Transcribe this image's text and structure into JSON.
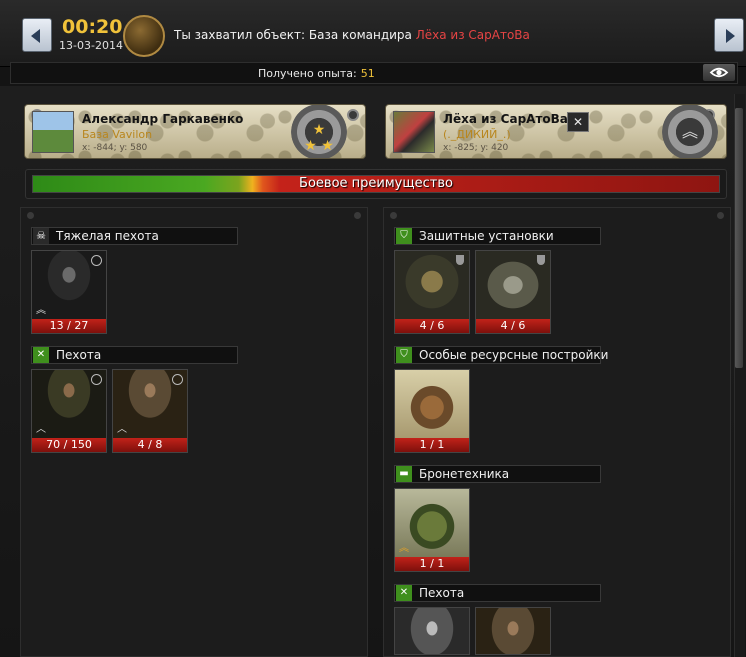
{
  "header": {
    "time": "00:20",
    "date": "13-03-2014",
    "headline_prefix": "Ты захватил объект: База командира",
    "headline_enemy": "Лёха из СарАтоВа",
    "xp_label": "Получено опыта:",
    "xp_value": "51",
    "prev_icon": "chevron-left-icon",
    "next_icon": "chevron-right-icon",
    "eye_icon": "eye-icon"
  },
  "players": {
    "left": {
      "name": "Александр Гаркавенко",
      "base": "База Vavilon",
      "coords": "x: -844; y: 580"
    },
    "right": {
      "name": "Лёха из СарАтоВа",
      "base": "(._ДИКИЙ_.)",
      "coords": "x: -825; y: 420",
      "close_label": "✕"
    }
  },
  "advantage": {
    "label": "Боевое преимущество",
    "player_share_percent": 32
  },
  "left_column": {
    "categories": [
      {
        "label": "Тяжелая пехота",
        "icon": "skull-icon",
        "units": [
          {
            "have": "13",
            "total": "27"
          }
        ]
      },
      {
        "label": "Пехота",
        "icon": "crossed-swords-icon",
        "units": [
          {
            "have": "70",
            "total": "150"
          },
          {
            "have": "4",
            "total": "8"
          }
        ]
      }
    ]
  },
  "right_column": {
    "categories": [
      {
        "label": "Зашитные установки",
        "icon": "shield-icon",
        "units": [
          {
            "have": "4",
            "total": "6"
          },
          {
            "have": "4",
            "total": "6"
          }
        ]
      },
      {
        "label": "Особые ресурсные постройки",
        "icon": "shield-icon",
        "units": [
          {
            "have": "1",
            "total": "1"
          }
        ]
      },
      {
        "label": "Бронетехника",
        "icon": "tank-icon",
        "units": [
          {
            "have": "1",
            "total": "1"
          }
        ]
      },
      {
        "label": "Пехота",
        "icon": "crossed-swords-icon",
        "units": []
      }
    ]
  },
  "colors": {
    "accent_gold": "#f0c23a",
    "enemy_red": "#e64444",
    "base_orange": "#b8861e",
    "count_red": "#c2221a",
    "category_green": "#3f8f1d"
  }
}
